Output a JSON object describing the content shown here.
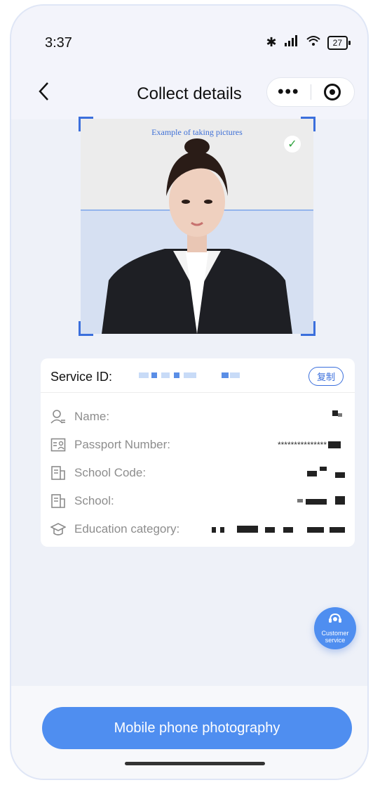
{
  "status_bar": {
    "time": "3:37",
    "signal_text": "✱ ῑ ᴴᴰ",
    "battery": "27"
  },
  "nav": {
    "back_glyph": "<",
    "title": "Collect details",
    "more_glyph": "•••"
  },
  "photo_example": {
    "caption": "Example of taking pictures",
    "check_glyph": "✓",
    "accent_color": "#3b6fdc"
  },
  "service": {
    "label": "Service ID:",
    "copy_label": "复制"
  },
  "fields": [
    {
      "label": "Name:",
      "icon": "person-icon"
    },
    {
      "label": "Passport Number:",
      "icon": "id-card-icon",
      "value": "***************"
    },
    {
      "label": "School Code:",
      "icon": "building-icon"
    },
    {
      "label": "School:",
      "icon": "building-icon"
    },
    {
      "label": "Education category:",
      "icon": "graduation-cap-icon"
    }
  ],
  "customer_service": {
    "line1": "Customer",
    "line2": "service"
  },
  "bottom": {
    "button_label": "Mobile phone photography"
  },
  "colors": {
    "primary": "#4f8ef0",
    "background": "#eef1f8"
  }
}
